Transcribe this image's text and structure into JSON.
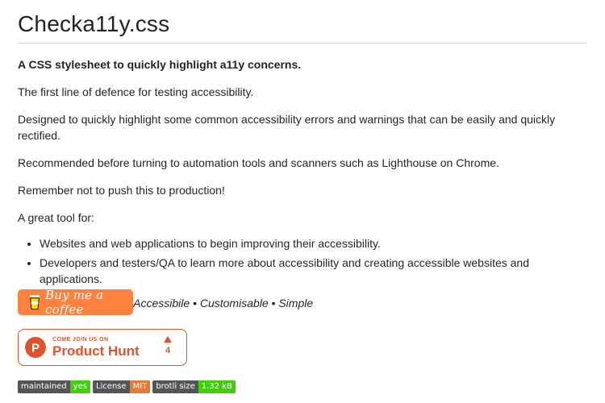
{
  "title": "Checka11y.css",
  "lead": "A CSS stylesheet to quickly highlight a11y concerns.",
  "paragraphs": [
    "The first line of defence for testing accessibility.",
    "Designed to quickly highlight some common accessibility errors and warnings that can be easily and quickly rectified.",
    "Recommended before turning to automation tools and scanners such as Lighthouse on Chrome.",
    "Remember not to push this to production!",
    "A great tool for:"
  ],
  "list": [
    "Websites and web applications to begin improving their accessibility.",
    "Developers and testers/QA to learn more about accessibility and creating accessible websites and applications."
  ],
  "tagline": "Lightweight • Modern • Accessibile • Customisable • Simple",
  "buy_me_coffee": {
    "label": "Buy me a coffee",
    "color": "#ff813f"
  },
  "product_hunt": {
    "small": "COME JOIN US ON",
    "big": "Product Hunt",
    "votes": "4",
    "logo_letter": "P",
    "color": "#da552f"
  },
  "badges": [
    {
      "label": "maintained",
      "value": "yes",
      "color": "#44cc11"
    },
    {
      "label": "License",
      "value": "MIT",
      "color": "#e67a33"
    },
    {
      "label": "brotli size",
      "value": "1.32 kB",
      "color": "#44cc11"
    }
  ]
}
